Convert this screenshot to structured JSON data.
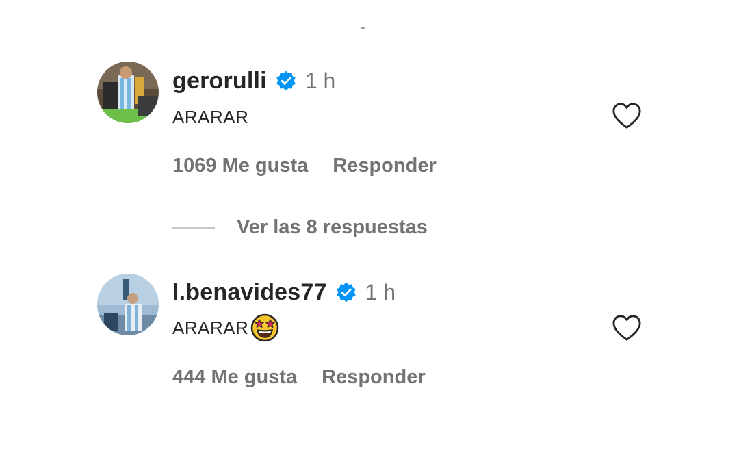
{
  "comments": [
    {
      "username": "gerorulli",
      "time": "1 h",
      "text": "ARARAR",
      "emoji": "",
      "likes": "1069 Me gusta",
      "reply_label": "Responder"
    },
    {
      "username": "l.benavides77",
      "time": "1 h",
      "text": "ARARAR",
      "emoji": "star-struck-emoji",
      "likes": "444 Me gusta",
      "reply_label": "Responder"
    }
  ],
  "view_replies": {
    "label": "Ver las 8 respuestas"
  },
  "icons": {
    "verified": "verified-badge-icon",
    "like": "heart-outline-icon"
  },
  "colors": {
    "verified_blue": "#0095f6",
    "secondary_text": "#737373",
    "primary_text": "#262626"
  }
}
